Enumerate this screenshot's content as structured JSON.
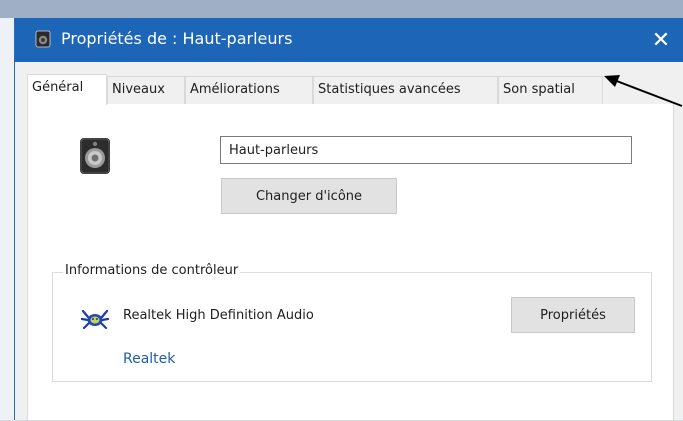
{
  "window": {
    "title": "Propriétés de : Haut-parleurs",
    "close_glyph": "✕",
    "accent_color": "#1c65b7"
  },
  "tabs": [
    {
      "label": "Général",
      "active": true
    },
    {
      "label": "Niveaux",
      "active": false
    },
    {
      "label": "Améliorations",
      "active": false
    },
    {
      "label": "Statistiques avancées",
      "active": false
    },
    {
      "label": "Son spatial",
      "active": false
    }
  ],
  "general": {
    "device_name_value": "Haut-parleurs",
    "change_icon_label": "Changer d'icône"
  },
  "controller": {
    "group_title": "Informations de contrôleur",
    "driver_name": "Realtek High Definition Audio",
    "properties_label": "Propriétés",
    "manufacturer_link": "Realtek"
  },
  "icons": {
    "title": "speaker-icon",
    "device": "speaker-icon",
    "driver": "realtek-crab-icon",
    "annotation": "arrow-icon"
  }
}
